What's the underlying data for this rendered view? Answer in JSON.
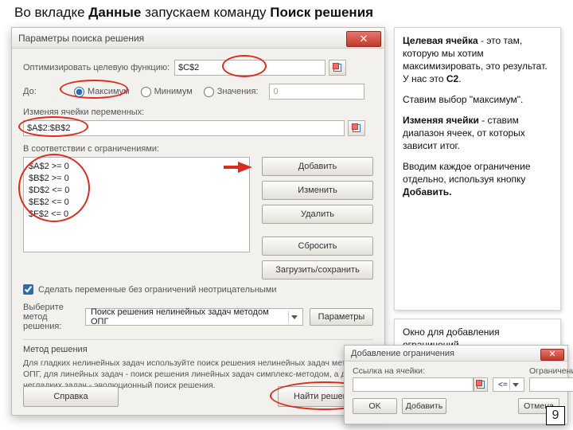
{
  "slide": {
    "title_pre": "Во вкладке ",
    "title_b1": "Данные",
    "title_mid": " запускаем команду ",
    "title_b2": "Поиск решения"
  },
  "solver": {
    "title": "Параметры поиска решения",
    "close": "✕",
    "obj_label": "Оптимизировать целевую функцию:",
    "obj_cell": "$C$2",
    "to_label": "До:",
    "radios": {
      "max": "Максимум",
      "min": "Минимум",
      "val": "Значения:"
    },
    "value_field": "0",
    "vars_label": "Изменяя ячейки переменных:",
    "vars_value": "$A$2:$B$2",
    "constr_label": "В соответствии с ограничениями:",
    "constraints": [
      "$A$2 >= 0",
      "$B$2 >= 0",
      "$D$2 <= 0",
      "$E$2 <= 0",
      "$F$2 <= 0"
    ],
    "buttons": {
      "add": "Добавить",
      "change": "Изменить",
      "delete": "Удалить",
      "reset": "Сбросить",
      "loadSave": "Загрузить/сохранить"
    },
    "nonneg": "Сделать переменные без ограничений неотрицательными",
    "method_label": "Выберите метод решения:",
    "method_value": "Поиск решения нелинейных задач методом ОПГ",
    "params_btn": "Параметры",
    "method_head": "Метод решения",
    "method_desc": "Для гладких нелинейных задач используйте поиск решения нелинейных задач методом ОПГ, для линейных задач - поиск решения линейных задач симплекс-методом, а для негладких задач - эволюционный поиск решения.",
    "help_btn": "Справка",
    "go_btn": "Найти решение"
  },
  "info1": {
    "p1a": "Целевая ячейка",
    "p1b": " - это там, которую мы хотим максимизировать, это результат. У нас это ",
    "p1c": "С2",
    "p1d": ".",
    "p2": "Ставим выбор \"максимум\".",
    "p3a": "Изменяя ячейки",
    "p3b": " - ставим диапазон ячеек, от которых зависит итог.",
    "p4a": "Вводим каждое ограничение отдельно, используя кнопку ",
    "p4b": "Добавить."
  },
  "info2": {
    "text": "Окно для добавления ограничений"
  },
  "addDlg": {
    "title": "Добавление ограничения",
    "close": "✕",
    "cellref_label": "Ссылка на ячейки:",
    "op_value": "<=",
    "rhs_label": "Ограничение:",
    "ok": "OK",
    "add": "Добавить",
    "cancel": "Отмена"
  },
  "page": "9"
}
